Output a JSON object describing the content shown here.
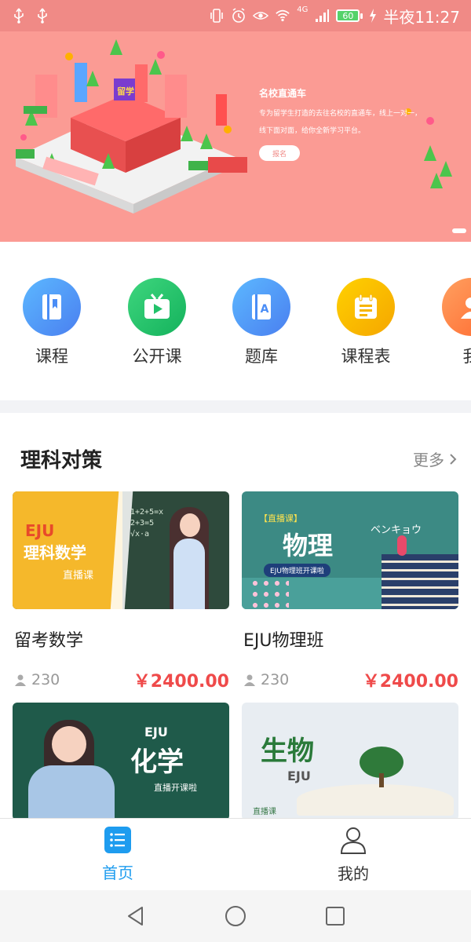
{
  "status_bar": {
    "time": "半夜11:27",
    "battery": "60",
    "network": "4G",
    "icons": [
      "usb-icon",
      "usb-icon",
      "vibrate-icon",
      "alarm-icon",
      "eye-icon",
      "wifi-icon",
      "signal-icon",
      "charging-icon"
    ]
  },
  "banner": {
    "title": "名校直通车",
    "description": "专为留学生打造的去往名校的直通车，线上一对一，线下面对面，给你全新学习平台。",
    "button_label": "报名",
    "colors": {
      "background": "#fb9b94"
    }
  },
  "quick_menu": [
    {
      "label": "课程",
      "icon": "book-icon",
      "color": "#4a8df6"
    },
    {
      "label": "公开课",
      "icon": "tv-play-icon",
      "color": "#22c26a"
    },
    {
      "label": "题库",
      "icon": "question-bank-icon",
      "color": "#4a8df6"
    },
    {
      "label": "课程表",
      "icon": "schedule-icon",
      "color": "#f7b500"
    },
    {
      "label": "我",
      "icon": "user-icon",
      "color": "#ff7a45"
    }
  ],
  "section": {
    "title": "理科对策",
    "more_label": "更多"
  },
  "courses": [
    {
      "title": "留考数学",
      "students": "230",
      "price": "￥2400.00",
      "thumb_text": [
        "EJU",
        "理科数学",
        "直播课"
      ]
    },
    {
      "title": "EJU物理班",
      "students": "230",
      "price": "￥2400.00",
      "thumb_text": [
        "【直播课】",
        "物理",
        "ベンキョウ",
        "EJU物理班开课啦"
      ]
    },
    {
      "title": "",
      "students": "",
      "price": "",
      "thumb_text": [
        "EJU",
        "化学",
        "直播开课啦"
      ]
    },
    {
      "title": "",
      "students": "",
      "price": "",
      "thumb_text": [
        "生物",
        "EJU",
        "直播课"
      ]
    }
  ],
  "tabbar": [
    {
      "label": "首页",
      "icon": "home-list-icon",
      "active": true
    },
    {
      "label": "我的",
      "icon": "profile-icon",
      "active": false
    }
  ],
  "accent_colors": {
    "primary": "#1e9cef",
    "price": "#ef4a4a"
  }
}
